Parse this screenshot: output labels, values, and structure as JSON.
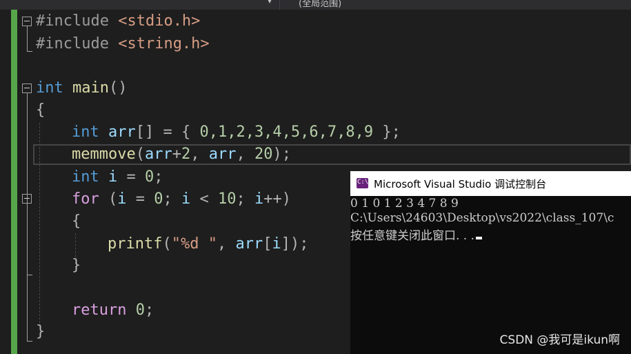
{
  "toolbar": {
    "scope_label": "(全局范围)",
    "dropdown_arrow": "▾"
  },
  "code": {
    "line1": {
      "pre": "#include",
      "str": "<stdio.h>"
    },
    "line2": {
      "pre": "#include",
      "str": "<string.h>"
    },
    "line4": {
      "kw": "int",
      "fn": "main",
      "rest": "()"
    },
    "line5": "{",
    "line6": {
      "kw": "int",
      "var": "arr",
      "rest1": "[] = { ",
      "nums": "0,1,2,3,4,5,6,7,8,9",
      "rest2": " };"
    },
    "line7": {
      "fn": "memmove",
      "p1": "(",
      "var1": "arr",
      "op": "+",
      "n1": "2",
      "p2": ", ",
      "var2": "arr",
      "p3": ", ",
      "n2": "20",
      "p4": ");"
    },
    "line8": {
      "kw": "int",
      "var": "i",
      "rest": " = ",
      "num": "0",
      "end": ";"
    },
    "line9": {
      "kw": "for",
      "p1": " (",
      "var1": "i",
      "eq": " = ",
      "n0": "0",
      "sc1": "; ",
      "var2": "i",
      "lt": " < ",
      "n10": "10",
      "sc2": "; ",
      "var3": "i",
      "inc": "++)"
    },
    "line10": "{",
    "line11": {
      "fn": "printf",
      "p1": "(",
      "str": "\"%d \"",
      "p2": ", ",
      "var": "arr",
      "br1": "[",
      "var2": "i",
      "br2": "]);"
    },
    "line12": "}",
    "line14": {
      "kw": "return",
      "num": "0",
      "end": ";"
    },
    "line15": "}"
  },
  "console": {
    "title": "Microsoft Visual Studio 调试控制台",
    "icon": "visual-studio-console-icon",
    "output_line1": "0 1 0 1 2 3 4 7 8 9",
    "output_line2": "C:\\Users\\24603\\Desktop\\vs2022\\class_107\\c",
    "output_line3": "按任意键关闭此窗口. . ."
  },
  "watermark": "CSDN @我可是ikun啊"
}
